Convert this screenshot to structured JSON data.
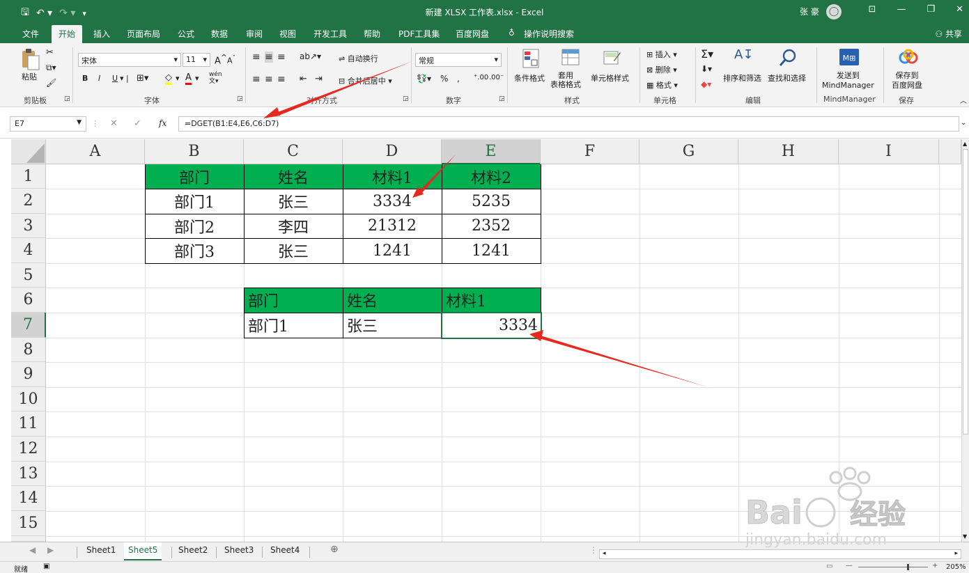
{
  "window": {
    "title": "新建 XLSX 工作表.xlsx  -  Excel",
    "user": "张 豪"
  },
  "menu": {
    "tabs": [
      "文件",
      "开始",
      "插入",
      "页面布局",
      "公式",
      "数据",
      "审阅",
      "视图",
      "开发工具",
      "帮助",
      "PDF工具集",
      "百度网盘"
    ],
    "search": "操作说明搜索",
    "share": "共享"
  },
  "ribbon": {
    "clipboard": {
      "label": "剪贴板",
      "paste": "粘贴"
    },
    "font": {
      "label": "字体",
      "name": "宋体",
      "size": "11",
      "bold": "B",
      "italic": "I",
      "underline": "U",
      "wen": "wén",
      "grow": "A",
      "shrink": "A"
    },
    "alignment": {
      "label": "对齐方式",
      "wrap": "自动换行",
      "merge": "合并后居中"
    },
    "number": {
      "label": "数字",
      "format": "常规",
      "percent": "%",
      "comma": ","
    },
    "styles": {
      "label": "样式",
      "conditional": "条件格式",
      "table_format": "套用\n表格格式",
      "cell_styles": "单元格样式"
    },
    "cells": {
      "label": "单元格",
      "insert": "插入",
      "delete": "删除",
      "format": "格式"
    },
    "editing": {
      "label": "编辑",
      "sort": "排序和筛选",
      "find": "查找和选择"
    },
    "mindmanager": {
      "label": "MindManager",
      "send": "发送到\nMindManager"
    },
    "save": {
      "label": "保存",
      "save_to": "保存到\n百度网盘"
    }
  },
  "formula_bar": {
    "name_box": "E7",
    "fx": "fx",
    "formula": "=DGET(B1:E4,E6,C6:D7)"
  },
  "grid": {
    "columns": [
      "A",
      "B",
      "C",
      "D",
      "E",
      "F",
      "G",
      "H",
      "I"
    ],
    "rows": [
      "1",
      "2",
      "3",
      "4",
      "5",
      "6",
      "7",
      "8",
      "9",
      "10",
      "11",
      "12",
      "13",
      "14",
      "15"
    ],
    "table1": {
      "headers": [
        "部门",
        "姓名",
        "材料1",
        "材料2"
      ],
      "rows": [
        [
          "部门1",
          "张三",
          "3334",
          "5235"
        ],
        [
          "部门2",
          "李四",
          "21312",
          "2352"
        ],
        [
          "部门3",
          "张三",
          "1241",
          "1241"
        ]
      ]
    },
    "table2": {
      "headers": [
        "部门",
        "姓名",
        "材料1"
      ],
      "values": [
        "部门1",
        "张三",
        "3334"
      ]
    }
  },
  "sheets": {
    "tabs": [
      "Sheet1",
      "Sheet5",
      "Sheet2",
      "Sheet3",
      "Sheet4"
    ],
    "active": "Sheet5"
  },
  "status": {
    "ready": "就绪",
    "zoom": "205%"
  },
  "colors": {
    "excel_green": "#217346",
    "header_fill": "#00b050",
    "arrow_red": "#e8281e"
  }
}
